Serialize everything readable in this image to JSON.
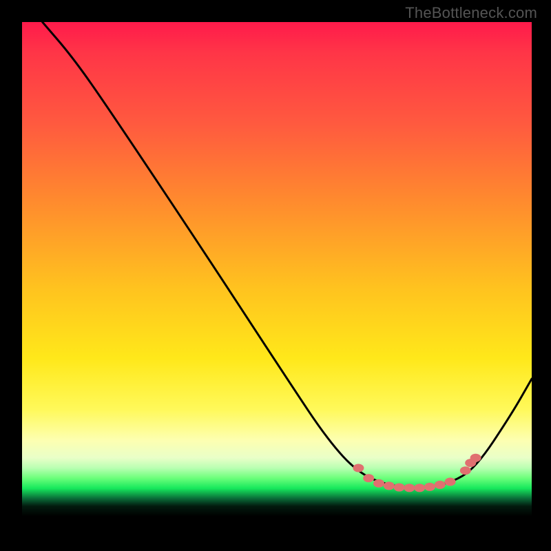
{
  "watermark": "TheBottleneck.com",
  "chart_data": {
    "type": "line",
    "title": "",
    "xlabel": "",
    "ylabel": "",
    "xlim": [
      0,
      100
    ],
    "ylim": [
      0,
      100
    ],
    "curve": [
      {
        "x": 4,
        "y": 100
      },
      {
        "x": 10,
        "y": 93
      },
      {
        "x": 17,
        "y": 83
      },
      {
        "x": 35,
        "y": 56
      },
      {
        "x": 52,
        "y": 30
      },
      {
        "x": 60,
        "y": 18
      },
      {
        "x": 66,
        "y": 11.5
      },
      {
        "x": 72,
        "y": 9.0
      },
      {
        "x": 78,
        "y": 8.5
      },
      {
        "x": 84,
        "y": 9.5
      },
      {
        "x": 89,
        "y": 12.5
      },
      {
        "x": 96,
        "y": 23
      },
      {
        "x": 100,
        "y": 30
      }
    ],
    "series": [
      {
        "name": "markers",
        "color": "#e07070",
        "points": [
          {
            "x": 66,
            "y": 12.5
          },
          {
            "x": 68,
            "y": 10.5
          },
          {
            "x": 70,
            "y": 9.5
          },
          {
            "x": 72,
            "y": 9.0
          },
          {
            "x": 74,
            "y": 8.7
          },
          {
            "x": 76,
            "y": 8.6
          },
          {
            "x": 78,
            "y": 8.6
          },
          {
            "x": 80,
            "y": 8.8
          },
          {
            "x": 82,
            "y": 9.2
          },
          {
            "x": 84,
            "y": 9.8
          },
          {
            "x": 87,
            "y": 12.0
          },
          {
            "x": 88,
            "y": 13.5
          },
          {
            "x": 89,
            "y": 14.5
          }
        ]
      }
    ]
  }
}
